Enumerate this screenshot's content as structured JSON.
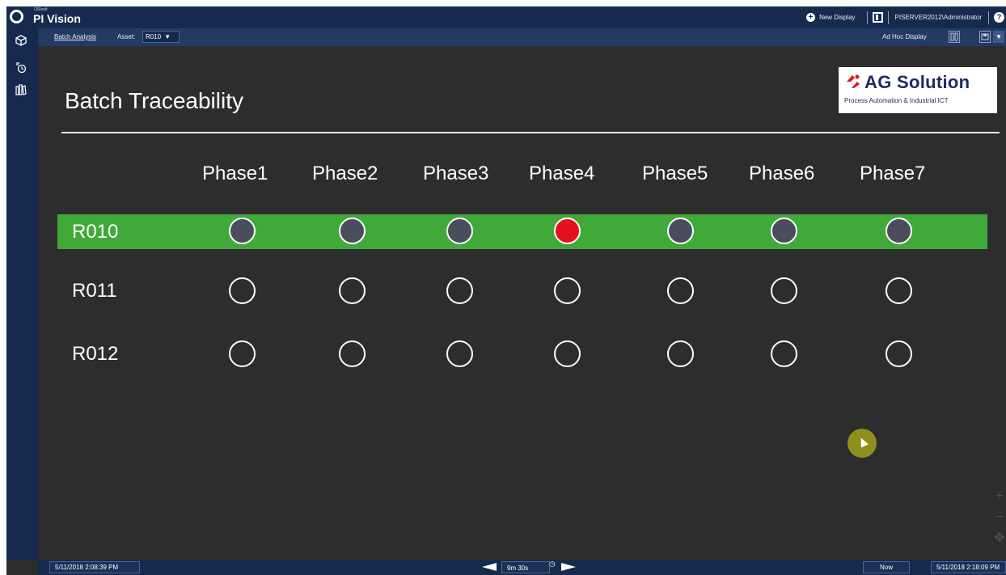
{
  "app": {
    "brand_small": "OSIsoft",
    "brand": "PI Vision",
    "new_display": "New Display",
    "user": "PISERVER2012\\Administrator",
    "help": "?"
  },
  "toolbar": {
    "breadcrumb": "Batch Analysis",
    "asset_label": "Asset:",
    "asset_value": "R010",
    "adhoc": "Ad Hoc Display"
  },
  "display": {
    "title": "Batch Traceability",
    "logo_name": "AG Solution",
    "logo_subtitle": "Process Automation & Industrial ICT",
    "phases": [
      "Phase1",
      "Phase2",
      "Phase3",
      "Phase4",
      "Phase5",
      "Phase6",
      "Phase7"
    ],
    "rows": [
      {
        "label": "R010",
        "selected": true,
        "states": [
          "grey",
          "grey",
          "grey",
          "red",
          "grey",
          "grey",
          "grey"
        ]
      },
      {
        "label": "R011",
        "selected": false,
        "states": [
          "empty",
          "empty",
          "empty",
          "empty",
          "empty",
          "empty",
          "empty"
        ]
      },
      {
        "label": "R012",
        "selected": false,
        "states": [
          "empty",
          "empty",
          "empty",
          "empty",
          "empty",
          "empty",
          "empty"
        ]
      }
    ],
    "colors": {
      "selected_row": "#41a93a",
      "active": "#e3121c",
      "inactive": "#4a4d5c"
    }
  },
  "timebar": {
    "start": "5/11/2018 2:08:39 PM",
    "duration": "9m 30s",
    "now": "Now",
    "end": "5/11/2018 2:18:09 PM"
  }
}
